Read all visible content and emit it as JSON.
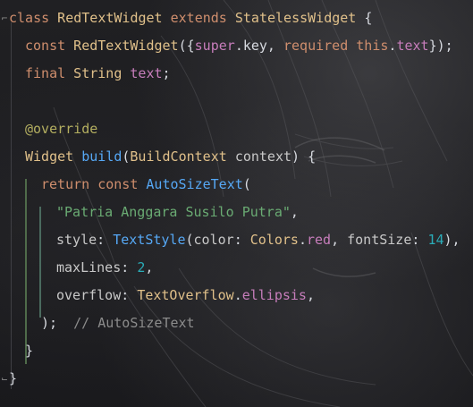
{
  "code": {
    "line1": {
      "kw1": "class",
      "cls1": " RedTextWidget",
      "kw2": " extends",
      "cls2": " StatelessWidget",
      "p1": " {"
    },
    "line2": {
      "kw1": "const",
      "cls1": " RedTextWidget",
      "p1": "({",
      "field1": "super",
      "p2": ".key, ",
      "kw2": "required",
      "p3": " ",
      "field2": "this",
      "p4": ".",
      "field3": "text",
      "p5": "});"
    },
    "line3": {
      "kw1": "final",
      "cls1": " String",
      "p1": " ",
      "field1": "text",
      "p2": ";"
    },
    "line5": {
      "ann": "@override"
    },
    "line6": {
      "cls1": "Widget",
      "p1": " ",
      "fn1": "build",
      "p2": "(",
      "cls2": "BuildContext",
      "p3": " ",
      "param": "context",
      "p4": ") {"
    },
    "line7": {
      "kw1": "return",
      "kw2": " const",
      "p1": " ",
      "fn1": "AutoSizeText",
      "p2": "("
    },
    "line8": {
      "str": "\"Patria Anggara Susilo Putra\"",
      "p1": ","
    },
    "line9": {
      "param1": "style",
      "p1": ": ",
      "fn1": "TextStyle",
      "p2": "(",
      "param2": "color",
      "p3": ": ",
      "cls1": "Colors",
      "p4": ".",
      "field1": "red",
      "p5": ", ",
      "param3": "fontSize",
      "p6": ": ",
      "num": "14",
      "p7": "),"
    },
    "line10": {
      "param1": "maxLines",
      "p1": ": ",
      "num": "2",
      "p2": ","
    },
    "line11": {
      "param1": "overflow",
      "p1": ": ",
      "cls1": "TextOverflow",
      "p2": ".",
      "field1": "ellipsis",
      "p3": ","
    },
    "line12": {
      "p1": ");",
      "cmt": "  // AutoSizeText"
    },
    "line13": {
      "p1": "}"
    },
    "line14": {
      "p1": "}"
    }
  },
  "colors": {
    "keyword": "#cf8e6d",
    "class": "#e0c08a",
    "function": "#56a8f5",
    "field": "#c77dbb",
    "string": "#6aab73",
    "number": "#2aacb8",
    "annotation": "#b3ae60",
    "comment": "#8c8c8c",
    "guide_outer": "#4f6b4a",
    "guide_inner": "#4a6a5e",
    "guide_mid": "#5f6b45"
  }
}
